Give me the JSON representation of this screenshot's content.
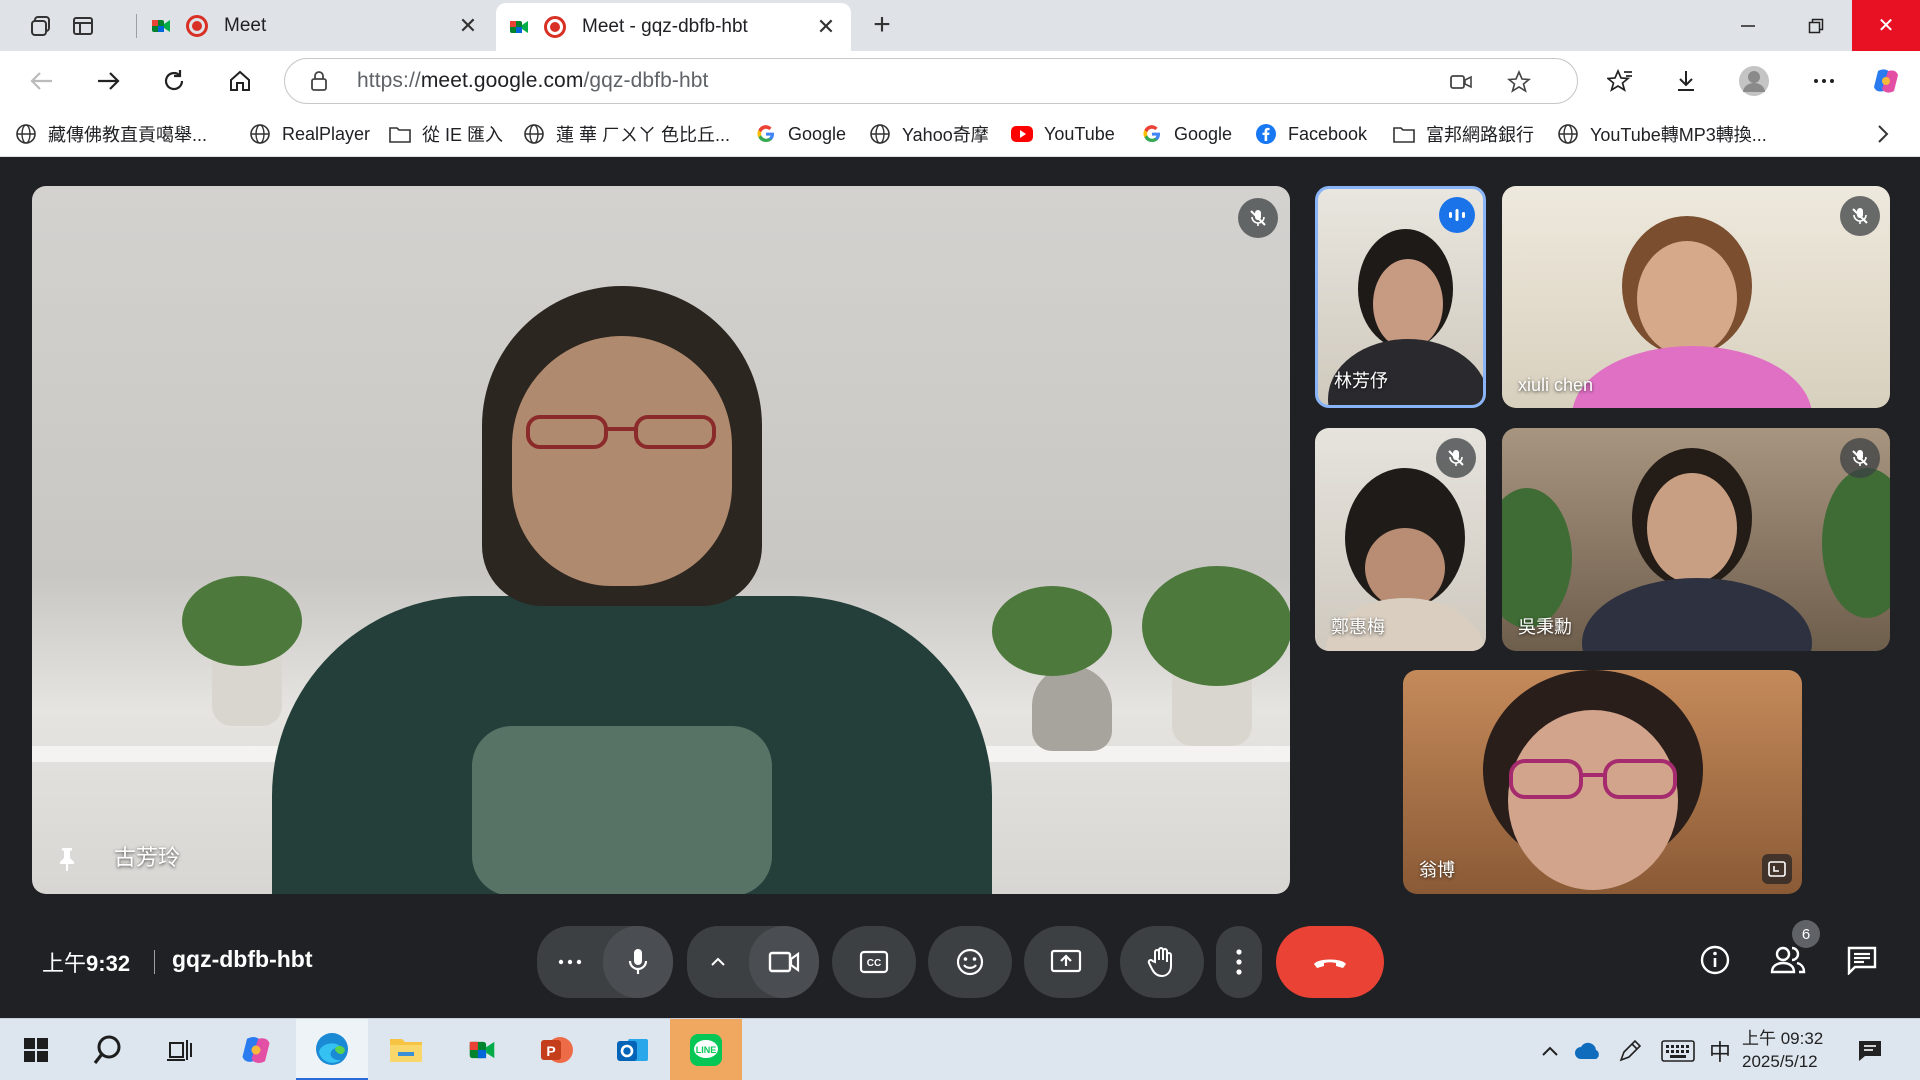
{
  "browser": {
    "tabs": [
      {
        "title": "Meet",
        "active": false
      },
      {
        "title": "Meet - gqz-dbfb-hbt",
        "active": true
      }
    ],
    "url": {
      "scheme": "https://",
      "host": "meet.google.com",
      "path": "/gqz-dbfb-hbt"
    },
    "bookmarks": [
      {
        "label": "藏傳佛教直貢噶舉...",
        "icon": "globe-icon"
      },
      {
        "label": "RealPlayer",
        "icon": "globe-icon"
      },
      {
        "label": "從 IE 匯入",
        "icon": "folder-icon"
      },
      {
        "label": "蓮 華 ㄏㄨㄚ 色比丘...",
        "icon": "globe-icon"
      },
      {
        "label": "Google",
        "icon": "google-icon"
      },
      {
        "label": "Yahoo奇摩",
        "icon": "globe-icon"
      },
      {
        "label": "YouTube",
        "icon": "youtube-icon"
      },
      {
        "label": "Google",
        "icon": "google-icon"
      },
      {
        "label": "Facebook",
        "icon": "facebook-icon"
      },
      {
        "label": "富邦網路銀行",
        "icon": "folder-icon"
      },
      {
        "label": "YouTube轉MP3轉換...",
        "icon": "globe-icon"
      }
    ]
  },
  "meet": {
    "pinned_participant": "古芳玲",
    "participants": [
      {
        "name": "林芳伃",
        "speaking": true
      },
      {
        "name": "xiuli chen",
        "muted": true
      },
      {
        "name": "鄭惠梅",
        "muted": true
      },
      {
        "name": "吳秉勳",
        "muted": true
      },
      {
        "name": "翁博",
        "muted": false
      }
    ],
    "time_prefix": "上午",
    "time": "9:32",
    "meeting_code": "gqz-dbfb-hbt",
    "participant_count": "6",
    "colors": {
      "end_call": "#ea4335",
      "speaking": "#1a73e8",
      "control_bg": "#3c4043"
    }
  },
  "taskbar": {
    "ime": "中",
    "clock_time": "上午 09:32",
    "clock_date": "2025/5/12"
  }
}
